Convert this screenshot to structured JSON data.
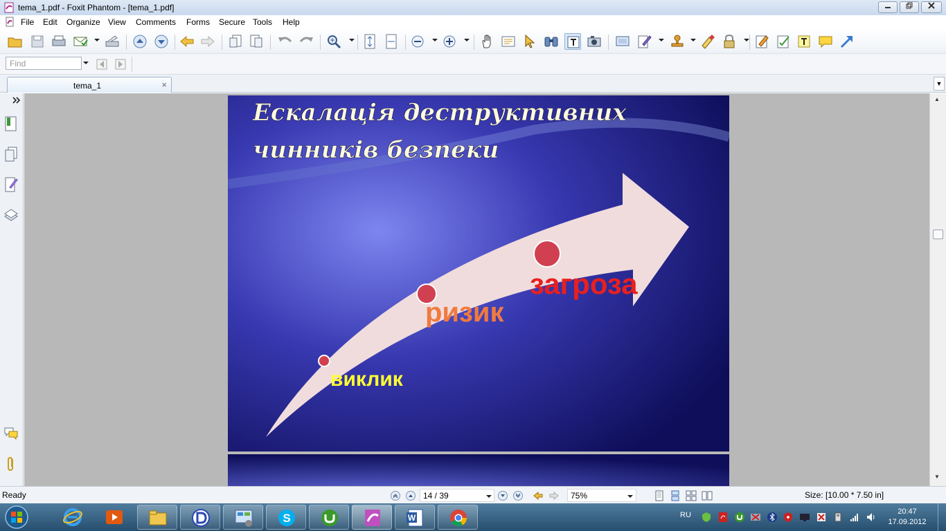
{
  "window": {
    "title": "tema_1.pdf - Foxit Phantom - [tema_1.pdf]",
    "buttons": [
      "minimize",
      "restore",
      "close"
    ]
  },
  "menu": {
    "items": [
      "File",
      "Edit",
      "Organize",
      "View",
      "Comments",
      "Forms",
      "Secure",
      "Tools",
      "Help"
    ]
  },
  "toolbar": {
    "icons": [
      "open-icon",
      "save-icon",
      "print-icon",
      "email-icon",
      "scan-icon",
      "prev-page-icon",
      "next-page-icon",
      "back-icon",
      "forward-icon",
      "insert-page-icon",
      "extract-page-icon",
      "undo-icon",
      "redo-icon",
      "zoom-icon",
      "fit-page-icon",
      "fit-width-icon",
      "zoom-out-icon",
      "zoom-in-icon",
      "hand-icon",
      "select-text-icon",
      "select-icon",
      "find-icon",
      "typewriter-icon",
      "snapshot-icon",
      "display-icon",
      "note-icon",
      "stamp-icon",
      "sign-icon",
      "lock-icon",
      "edit-icon",
      "form-icon",
      "textbox-icon",
      "comment-icon",
      "arrow-icon"
    ]
  },
  "find": {
    "placeholder": "Find"
  },
  "tab": {
    "label": "tema_1"
  },
  "slide": {
    "title_line1": "Ескалація деструктивних",
    "title_line2": "чинників безпеки",
    "label_challenge": "виклик",
    "label_risk": "ризик",
    "label_threat": "загроза",
    "colors": {
      "background": "#1a1a7a",
      "arrow": "#f0dcdc",
      "dot": "#d04050",
      "challenge": "#ffff33",
      "risk": "#f07a40",
      "threat": "#e82020",
      "title": "#fffbe0"
    }
  },
  "status": {
    "ready": "Ready",
    "page": "14 / 39",
    "zoom": "75%",
    "size": "Size: [10.00 * 7.50 in]"
  },
  "taskbar": {
    "apps": [
      "internet-explorer-icon",
      "media-player-icon",
      "explorer-icon",
      "daemon-tools-icon",
      "control-panel-icon",
      "skype-icon",
      "utorrent-icon",
      "foxit-icon",
      "word-icon",
      "chrome-icon"
    ],
    "lang": "RU",
    "time": "20:47",
    "date": "17.09.2012"
  }
}
